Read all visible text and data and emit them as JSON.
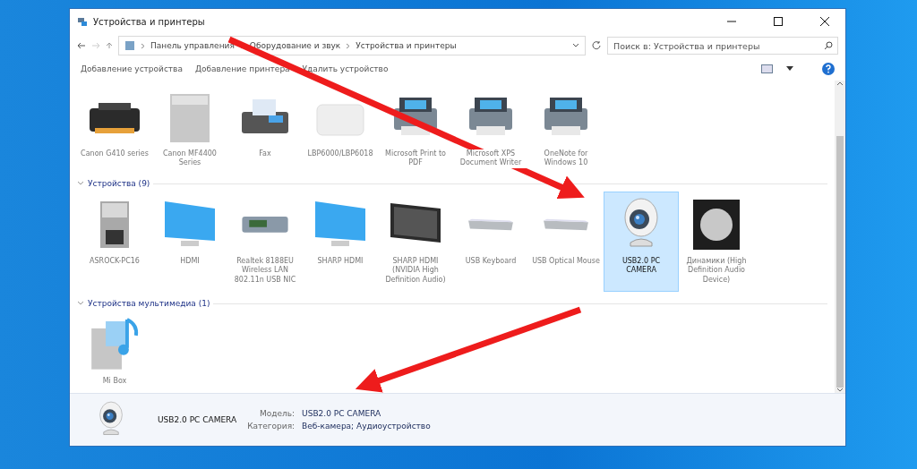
{
  "window": {
    "title": "Устройства и принтеры"
  },
  "address_bar": {
    "breadcrumbs": [
      "Панель управления",
      "Оборудование и звук",
      "Устройства и принтеры"
    ]
  },
  "search": {
    "placeholder": "Поиск в: Устройства и принтеры"
  },
  "command_bar": {
    "commands": [
      "Добавление устройства",
      "Добавление принтера",
      "Удалить устройство"
    ]
  },
  "printers": [
    {
      "label": "Canon G410 series",
      "kind": "inkjet",
      "selected": false
    },
    {
      "label": "Canon MF4400 Series",
      "kind": "mfp",
      "selected": false
    },
    {
      "label": "Fax",
      "kind": "fax",
      "selected": false
    },
    {
      "label": "LBP6000/LBP6018",
      "kind": "laser",
      "selected": false
    },
    {
      "label": "Microsoft Print to PDF",
      "kind": "printer",
      "selected": false
    },
    {
      "label": "Microsoft XPS Document Writer",
      "kind": "printer",
      "selected": false
    },
    {
      "label": "OneNote for Windows 10",
      "kind": "printer",
      "selected": false
    }
  ],
  "groups": [
    {
      "title": "Устройства (9)",
      "expanded": true,
      "items": [
        {
          "label": "ASROCK-PC16",
          "kind": "computer",
          "selected": false
        },
        {
          "label": "HDMI",
          "kind": "monitor",
          "selected": false
        },
        {
          "label": "Realtek 8188EU Wireless LAN 802.11n USB NIC",
          "kind": "adapter",
          "selected": false
        },
        {
          "label": "SHARP HDMI",
          "kind": "monitor",
          "selected": false
        },
        {
          "label": "SHARP HDMI (NVIDIA High Definition Audio)",
          "kind": "tv",
          "selected": false
        },
        {
          "label": "USB Keyboard",
          "kind": "keyboard",
          "selected": false
        },
        {
          "label": "USB Optical Mouse",
          "kind": "keyboard",
          "selected": false
        },
        {
          "label": "USB2.0 PC CAMERA",
          "kind": "webcam",
          "selected": true
        },
        {
          "label": "Динамики (High Definition Audio Device)",
          "kind": "speaker",
          "selected": false
        }
      ]
    },
    {
      "title": "Устройства мультимедиа (1)",
      "expanded": true,
      "items": [
        {
          "label": "Mi Box",
          "kind": "media",
          "selected": false
        }
      ]
    }
  ],
  "details": {
    "name": "USB2.0 PC CAMERA",
    "fields": [
      {
        "label": "Модель:",
        "value": "USB2.0 PC CAMERA"
      },
      {
        "label": "Категория:",
        "value": "Веб-камера; Аудиоустройство"
      }
    ]
  }
}
